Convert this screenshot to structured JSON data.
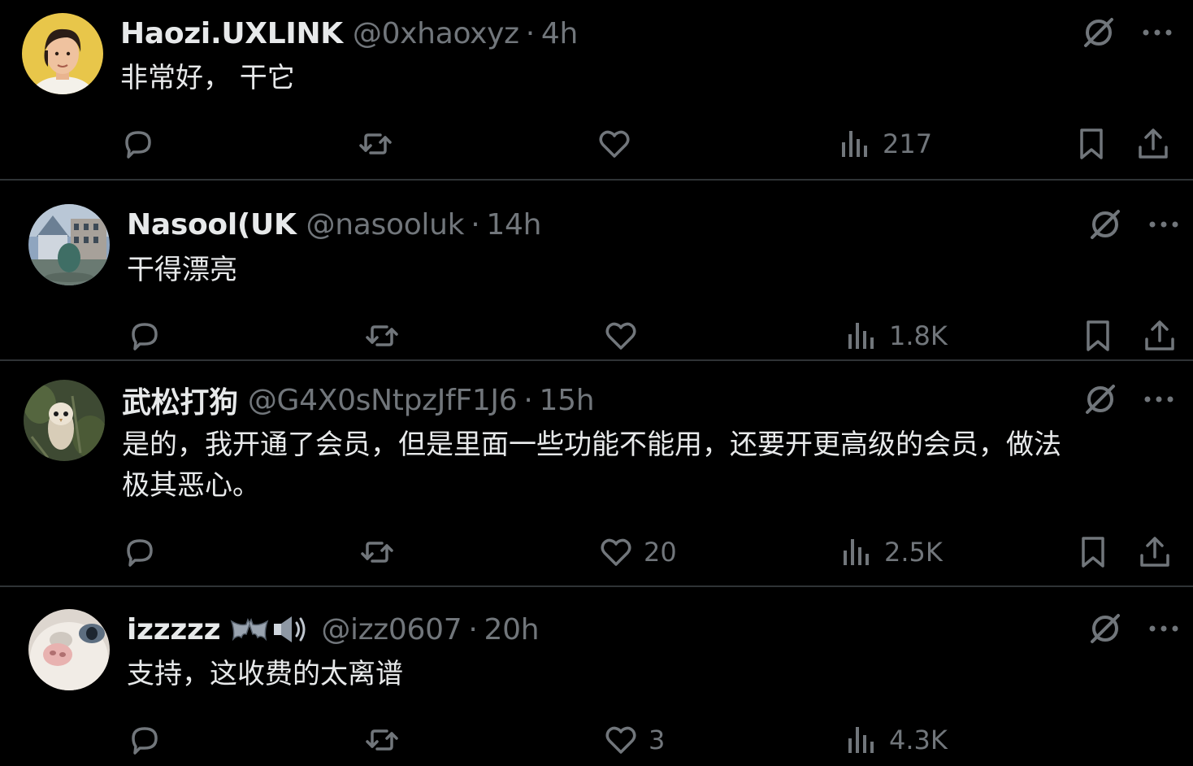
{
  "tweets": [
    {
      "name": "Haozi.UXLINK",
      "handle": "@0xhaoxyz",
      "time": "4h",
      "text": "非常好， 干它",
      "replies": "",
      "retweets": "",
      "likes": "",
      "views": "217"
    },
    {
      "name": "Nasool(UK",
      "handle": "@nasooluk",
      "time": "14h",
      "text": "干得漂亮",
      "replies": "",
      "retweets": "",
      "likes": "",
      "views": "1.8K"
    },
    {
      "name": "武松打狗",
      "handle": "@G4X0sNtpzJfF1J6",
      "time": "15h",
      "text": "是的，我开通了会员，但是里面一些功能不能用，还要开更高级的会员，做法\n极其恶心。",
      "replies": "",
      "retweets": "",
      "likes": "20",
      "views": "2.5K"
    },
    {
      "name": "izzzzz",
      "handle": "@izz0607",
      "time": "20h",
      "text": "支持，这收费的太离谱",
      "replies": "",
      "retweets": "",
      "likes": "3",
      "views": "4.3K"
    }
  ],
  "separator": "·",
  "icons": {
    "grok": "grok-icon",
    "more": "more-icon",
    "reply": "reply-icon",
    "retweet": "retweet-icon",
    "like": "heart-icon",
    "views": "views-icon",
    "bookmark": "bookmark-icon",
    "share": "share-icon",
    "emoji1": "bat-emoji",
    "emoji2": "speaker-emoji"
  },
  "colors": {
    "background": "#000000",
    "text": "#e7e9ea",
    "muted": "#71767b",
    "divider": "#2f3336"
  }
}
